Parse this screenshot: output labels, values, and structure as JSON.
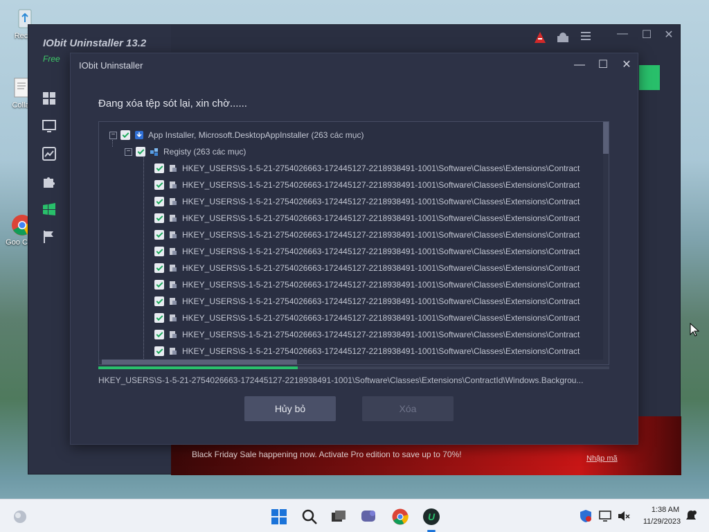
{
  "desktop": {
    "icons": [
      {
        "label": "Recyc",
        "icon": "recycle-bin-icon"
      },
      {
        "label": "Colla",
        "icon": "document-icon"
      },
      {
        "label": "Goo Chro",
        "icon": "chrome-icon"
      }
    ]
  },
  "main_app": {
    "title": "IObit Uninstaller 13.2",
    "edition": "Free",
    "sidebar_icons": [
      "grid-icon",
      "monitor-icon",
      "chart-icon",
      "puzzle-icon",
      "windows-icon",
      "flag-icon"
    ],
    "promo_text": "Black Friday Sale happening now. Activate Pro edition to save up to 70%!",
    "promo_link": "Nhập mã"
  },
  "dialog": {
    "title": "IObit Uninstaller",
    "status": "Đang xóa tệp sót lại, xin chờ......",
    "tree": {
      "root": "App Installer, Microsoft.DesktopAppInstaller (263 các mục)",
      "group": "Registy (263 các mục)",
      "entries": [
        "HKEY_USERS\\S-1-5-21-2754026663-172445127-2218938491-1001\\Software\\Classes\\Extensions\\Contract",
        "HKEY_USERS\\S-1-5-21-2754026663-172445127-2218938491-1001\\Software\\Classes\\Extensions\\Contract",
        "HKEY_USERS\\S-1-5-21-2754026663-172445127-2218938491-1001\\Software\\Classes\\Extensions\\Contract",
        "HKEY_USERS\\S-1-5-21-2754026663-172445127-2218938491-1001\\Software\\Classes\\Extensions\\Contract",
        "HKEY_USERS\\S-1-5-21-2754026663-172445127-2218938491-1001\\Software\\Classes\\Extensions\\Contract",
        "HKEY_USERS\\S-1-5-21-2754026663-172445127-2218938491-1001\\Software\\Classes\\Extensions\\Contract",
        "HKEY_USERS\\S-1-5-21-2754026663-172445127-2218938491-1001\\Software\\Classes\\Extensions\\Contract",
        "HKEY_USERS\\S-1-5-21-2754026663-172445127-2218938491-1001\\Software\\Classes\\Extensions\\Contract",
        "HKEY_USERS\\S-1-5-21-2754026663-172445127-2218938491-1001\\Software\\Classes\\Extensions\\Contract",
        "HKEY_USERS\\S-1-5-21-2754026663-172445127-2218938491-1001\\Software\\Classes\\Extensions\\Contract",
        "HKEY_USERS\\S-1-5-21-2754026663-172445127-2218938491-1001\\Software\\Classes\\Extensions\\Contract",
        "HKEY_USERS\\S-1-5-21-2754026663-172445127-2218938491-1001\\Software\\Classes\\Extensions\\Contract",
        "HKEY_USERS\\S-1-5-21-2754026663-172445127-2218938491-1001\\Software\\Classes\\Extensions\\Contract"
      ]
    },
    "progress": 0.39,
    "current_path": "HKEY_USERS\\S-1-5-21-2754026663-172445127-2218938491-1001\\Software\\Classes\\Extensions\\ContractId\\Windows.Backgrou...",
    "cancel_label": "Hủy bỏ",
    "delete_label": "Xóa"
  },
  "taskbar": {
    "time": "1:38 AM",
    "date": "11/29/2023",
    "apps": [
      "start-icon",
      "search-icon",
      "task-view-icon",
      "chat-icon",
      "chrome-icon",
      "iobit-icon"
    ]
  },
  "colors": {
    "accent": "#29c06b",
    "dialog_bg": "#2d3246",
    "promo": "#c81616"
  }
}
